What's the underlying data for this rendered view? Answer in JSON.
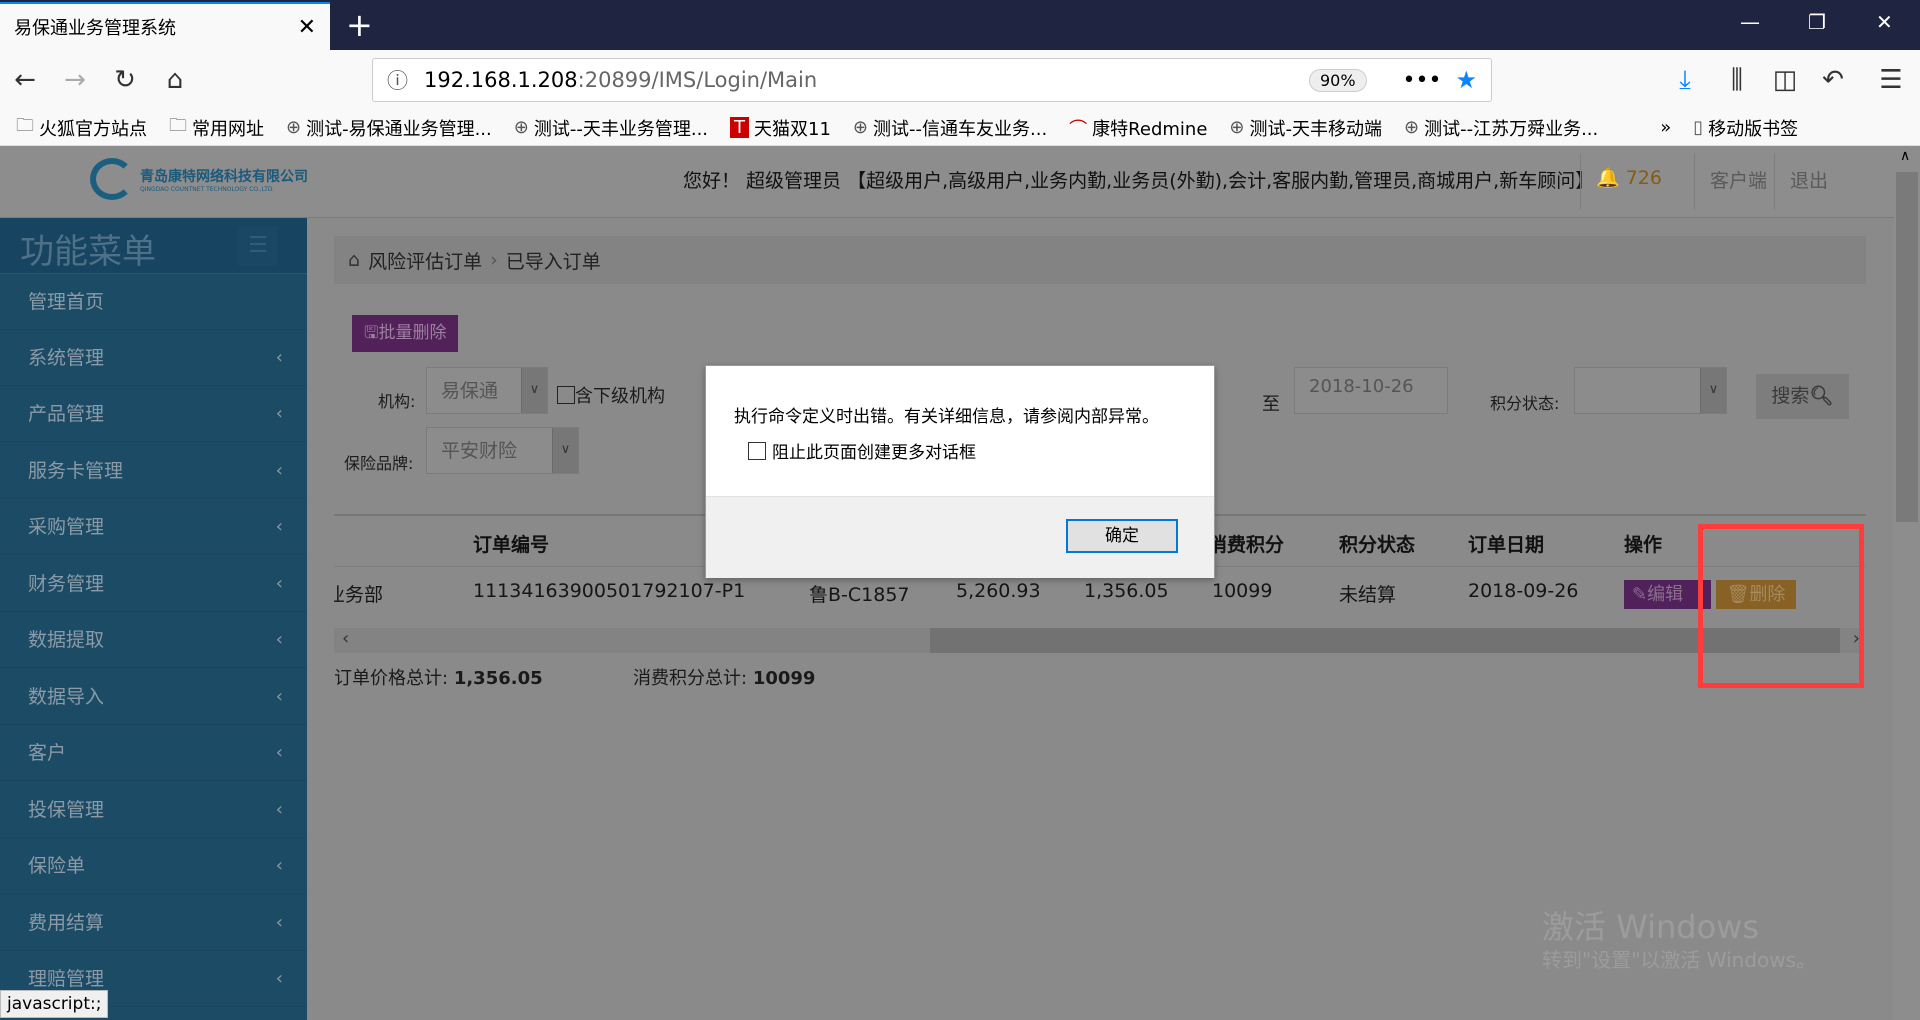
{
  "browser": {
    "tab_title": "易保通业务管理系统",
    "url_host": "192.168.1.208",
    "url_path": ":20899/IMS/Login/Main",
    "zoom": "90%",
    "bookmarks": [
      "火狐官方站点",
      "常用网址",
      "测试-易保通业务管理...",
      "测试--天丰业务管理...",
      "天猫双11",
      "测试--信通车友业务...",
      "康特Redmine",
      "测试-天丰移动端",
      "测试--江苏万舜业务..."
    ],
    "mobile_bookmarks": "移动版书签",
    "status_text": "javascript:;"
  },
  "header": {
    "company_cn": "青岛康特网络科技有限公司",
    "company_en": "QINGDAO COUNTNET TECHNOLOGY CO.,LTD.",
    "greeting": "您好！ 超级管理员 【超级用户,高级用户,业务内勤,业务员(外勤),会计,客服内勤,管理员,商城用户,新车顾问】",
    "notifications": "726",
    "client": "客户端",
    "logout": "退出"
  },
  "sidebar": {
    "title": "功能菜单",
    "items": [
      "管理首页",
      "系统管理",
      "产品管理",
      "服务卡管理",
      "采购管理",
      "财务管理",
      "数据提取",
      "数据导入",
      "客户",
      "投保管理",
      "保险单",
      "费用结算",
      "理赔管理"
    ]
  },
  "breadcrumb": {
    "root": "风险评估订单",
    "current": "已导入订单"
  },
  "toolbar": {
    "batch_delete": "批量删除"
  },
  "filters": {
    "org_label": "机构:",
    "org_value": "易保通",
    "include_sub": "含下级机构",
    "to_label": "至",
    "date_to": "2018-10-26",
    "points_status_label": "积分状态:",
    "points_status_value": "",
    "brand_label": "保险品牌:",
    "brand_value": "平安财险",
    "search": "搜索"
  },
  "table": {
    "headers": [
      "订单编号",
      "消费积分",
      "积分状态",
      "订单日期",
      "操作"
    ],
    "row": {
      "dept": "业务部",
      "order_no": "11134163900501792107-P1",
      "plate": "鲁B-C1857",
      "amount1": "5,260.93",
      "amount2": "1,356.05",
      "points": "10099",
      "status": "未结算",
      "date": "2018-09-26",
      "edit": "编辑",
      "delete": "删除"
    }
  },
  "totals": {
    "price_label": "订单价格总计:",
    "price": "1,356.05",
    "points_label": "消费积分总计:",
    "points": "10099"
  },
  "watermark": {
    "line1": "激活 Windows",
    "line2": "转到\"设置\"以激活 Windows。"
  },
  "dialog": {
    "message": "执行命令定义时出错。有关详细信息，请参阅内部异常。",
    "checkbox": "阻止此页面创建更多对话框",
    "ok": "确定"
  }
}
